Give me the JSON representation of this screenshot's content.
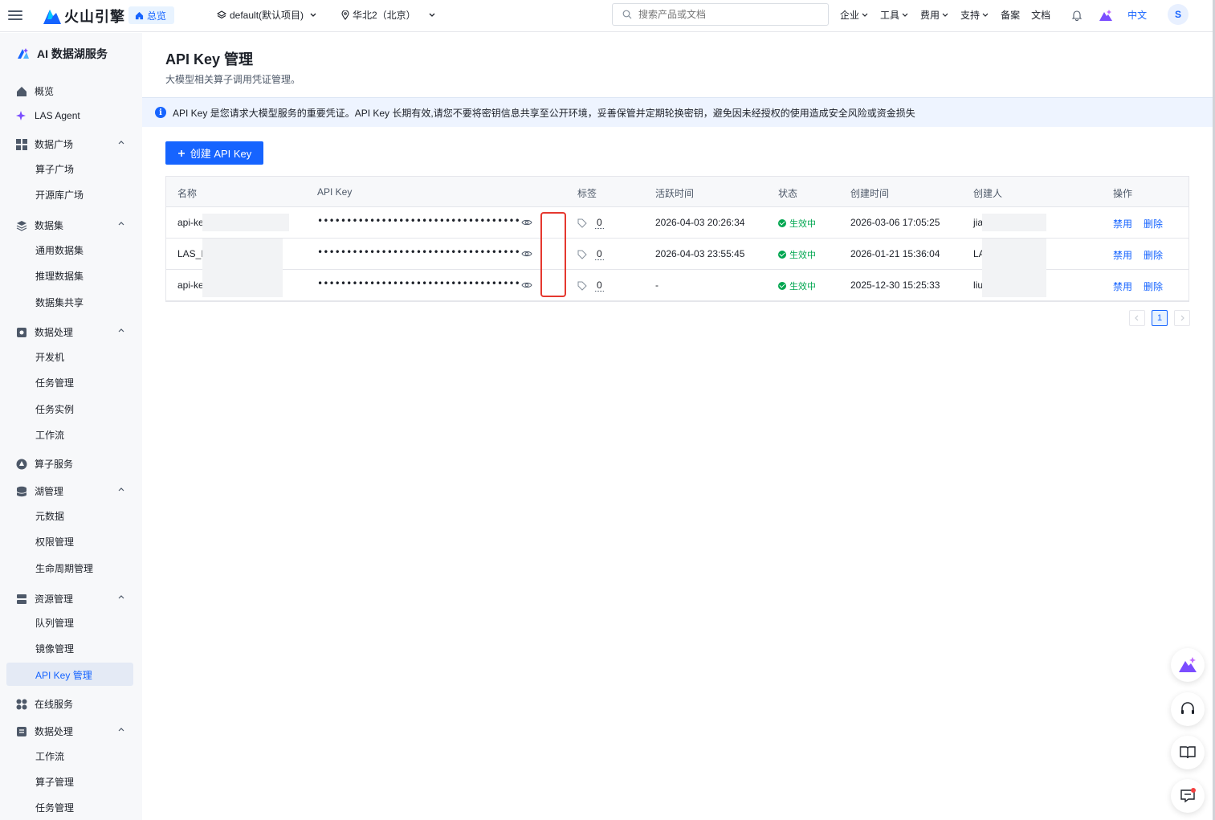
{
  "topbar": {
    "brand": "火山引擎",
    "overview": "总览",
    "project": "default(默认项目)",
    "region": "华北2（北京）",
    "search_placeholder": "搜索产品或文档",
    "nav": [
      "企业",
      "工具",
      "费用",
      "支持"
    ],
    "plain_links": [
      "备案",
      "文档"
    ],
    "lang": "中文",
    "avatar": "S"
  },
  "sidebar": {
    "title": "AI 数据湖服务",
    "overview": "概览",
    "agent": "LAS Agent",
    "data_square": "数据广场",
    "operator_square": "算子广场",
    "open_source": "开源库广场",
    "dataset": "数据集",
    "general_dataset": "通用数据集",
    "inference_dataset": "推理数据集",
    "dataset_share": "数据集共享",
    "data_process": "数据处理",
    "dev_machine": "开发机",
    "task_mgmt": "任务管理",
    "task_instance": "任务实例",
    "workflow": "工作流",
    "operator_service": "算子服务",
    "lake_mgmt": "湖管理",
    "metadata": "元数据",
    "permission": "权限管理",
    "lifecycle": "生命周期管理",
    "resource_mgmt": "资源管理",
    "queue_mgmt": "队列管理",
    "image_mgmt": "镜像管理",
    "apikey_mgmt": "API Key 管理",
    "online_service": "在线服务",
    "data_process2": "数据处理",
    "workflow2": "工作流",
    "operator_mgmt": "算子管理",
    "task_mgmt2": "任务管理"
  },
  "main": {
    "title": "API Key 管理",
    "subtitle": "大模型相关算子调用凭证管理。",
    "banner": "API Key 是您请求大模型服务的重要凭证。API Key 长期有效,请您不要将密钥信息共享至公开环境，妥善保管并定期轮换密钥，避免因未经授权的使用造成安全风险或资金损失",
    "create_button": "创建 API Key",
    "columns": [
      "名称",
      "API Key",
      "标签",
      "活跃时间",
      "状态",
      "创建时间",
      "创建人",
      "操作"
    ],
    "rows": [
      {
        "name": "api-ke",
        "key": "••••••••••••••••••••••••••••••••••••••••••••••••••••",
        "tags": "0",
        "active": "2026-04-03 20:26:34",
        "status": "生效中",
        "created": "2026-03-06 17:05:25",
        "creator": "jia",
        "disable": "禁用",
        "delete": "删除"
      },
      {
        "name": "LAS_I",
        "key": "••••••••••••••••••••••••••••••••••••••••••••••••••••",
        "tags": "0",
        "active": "2026-04-03 23:55:45",
        "status": "生效中",
        "created": "2026-01-21 15:36:04",
        "creator": "LA",
        "disable": "禁用",
        "delete": "删除"
      },
      {
        "name": "api-ke",
        "key": "••••••••••••••••••••••••••••••••••••••••••••••••••••",
        "tags": "0",
        "active": "-",
        "status": "生效中",
        "created": "2025-12-30 15:25:33",
        "creator": "liu",
        "disable": "禁用",
        "delete": "删除"
      }
    ],
    "page": "1"
  },
  "colors": {
    "accent": "#1664ff",
    "success": "#00a650",
    "highlight": "#e5382f"
  }
}
